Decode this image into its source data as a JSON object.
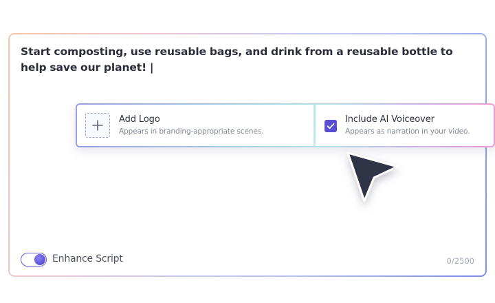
{
  "editor": {
    "script_text": "Start composting, use reusable bags, and drink from a reusable bottle to help save our planet! |",
    "char_count": "0/2500"
  },
  "options": {
    "logo": {
      "title": "Add Logo",
      "description": "Appears in branding-appropriate scenes.",
      "icon": "plus-icon"
    },
    "voiceover": {
      "title": "Include AI Voiceover",
      "description": "Appears as narration in your video.",
      "checked": true,
      "icon": "check-icon"
    }
  },
  "enhance": {
    "label": "Enhance Script",
    "enabled": true
  },
  "colors": {
    "accent": "#5a4ed2",
    "text": "#2b2d3a",
    "muted": "#818797"
  }
}
